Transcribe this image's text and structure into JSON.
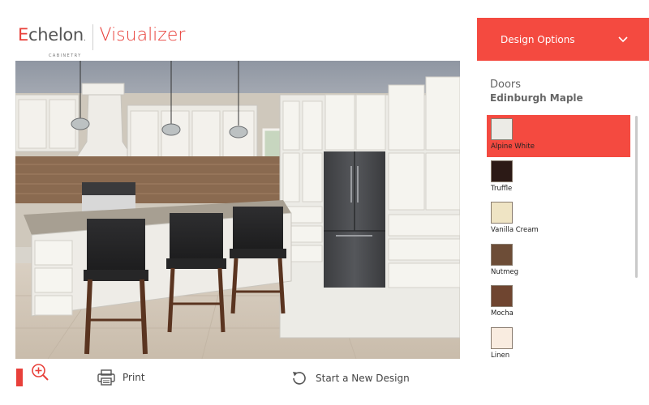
{
  "header": {
    "brand_e": "E",
    "brand_rest": "chelon",
    "brand_mark": ".",
    "brand_sub": "CABINETRY",
    "app_name": "Visualizer"
  },
  "toolbar": {
    "zoom_icon": "zoom-in-icon",
    "print_label": "Print",
    "print_icon": "printer-icon",
    "new_design_label": "Start a New Design",
    "new_design_icon": "refresh-icon"
  },
  "panel": {
    "dropdown_label": "Design Options",
    "dropdown_icon": "chevron-down-icon",
    "title": "Doors",
    "subtitle": "Edinburgh Maple",
    "swatches": [
      {
        "name": "Alpine White",
        "color": "#ecebe6",
        "selected": true
      },
      {
        "name": "Truffle",
        "color": "#2c1a16",
        "selected": false
      },
      {
        "name": "Vanilla Cream",
        "color": "#efe4c4",
        "selected": false
      },
      {
        "name": "Nutmeg",
        "color": "#6d4d37",
        "selected": false
      },
      {
        "name": "Mocha",
        "color": "#6f4530",
        "selected": false
      },
      {
        "name": "Linen",
        "color": "#f9ece0",
        "selected": false
      }
    ]
  },
  "colors": {
    "accent": "#f44a40"
  }
}
